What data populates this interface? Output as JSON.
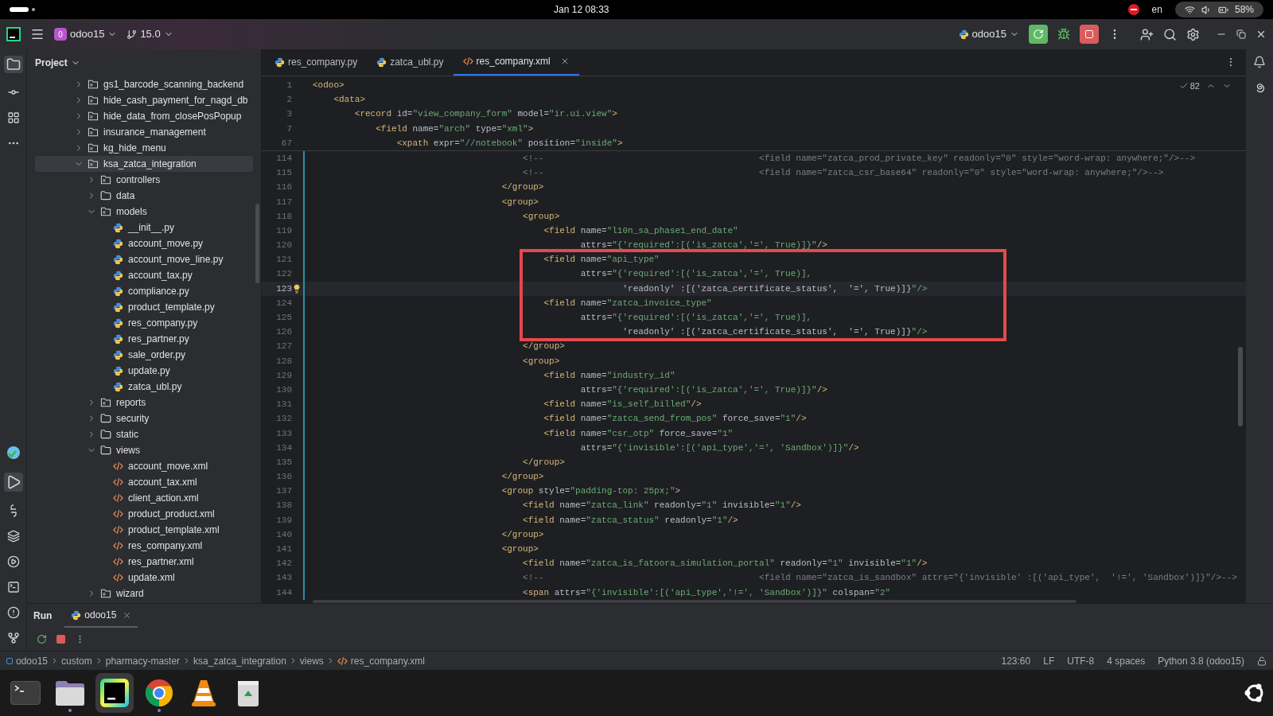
{
  "system_bar": {
    "date": "Jan 12",
    "time": "08:33",
    "language": "en",
    "battery": "58%"
  },
  "toolbar": {
    "project_badge": "0",
    "project": "odoo15",
    "branch": "15.0",
    "run_config": "odoo15"
  },
  "project_panel": {
    "title": "Project",
    "tree": [
      {
        "label": "gs1_barcode_scanning_backend",
        "kind": "package",
        "expanded": false,
        "selected": false
      },
      {
        "label": "hide_cash_payment_for_nagd_db",
        "kind": "package",
        "expanded": false,
        "selected": false
      },
      {
        "label": "hide_data_from_closePosPopup",
        "kind": "package",
        "expanded": false,
        "selected": false
      },
      {
        "label": "insurance_management",
        "kind": "package",
        "expanded": false,
        "selected": false
      },
      {
        "label": "kg_hide_menu",
        "kind": "package",
        "expanded": false,
        "selected": false
      },
      {
        "label": "ksa_zatca_integration",
        "kind": "package",
        "expanded": true,
        "selected": true,
        "children": [
          {
            "label": "controllers",
            "kind": "package",
            "expanded": false,
            "selected": false
          },
          {
            "label": "data",
            "kind": "folder",
            "expanded": false,
            "selected": false
          },
          {
            "label": "models",
            "kind": "package",
            "expanded": true,
            "selected": false,
            "children": [
              {
                "label": "__init__.py",
                "kind": "python",
                "selected": false
              },
              {
                "label": "account_move.py",
                "kind": "python",
                "selected": false
              },
              {
                "label": "account_move_line.py",
                "kind": "python",
                "selected": false
              },
              {
                "label": "account_tax.py",
                "kind": "python",
                "selected": false
              },
              {
                "label": "compliance.py",
                "kind": "python",
                "selected": false
              },
              {
                "label": "product_template.py",
                "kind": "python",
                "selected": false
              },
              {
                "label": "res_company.py",
                "kind": "python",
                "selected": false
              },
              {
                "label": "res_partner.py",
                "kind": "python",
                "selected": false
              },
              {
                "label": "sale_order.py",
                "kind": "python",
                "selected": false
              },
              {
                "label": "update.py",
                "kind": "python",
                "selected": false
              },
              {
                "label": "zatca_ubl.py",
                "kind": "python",
                "selected": false
              }
            ]
          },
          {
            "label": "reports",
            "kind": "package",
            "expanded": false,
            "selected": false
          },
          {
            "label": "security",
            "kind": "folder",
            "expanded": false,
            "selected": false
          },
          {
            "label": "static",
            "kind": "folder",
            "expanded": false,
            "selected": false
          },
          {
            "label": "views",
            "kind": "folder",
            "expanded": true,
            "selected": false,
            "children": [
              {
                "label": "account_move.xml",
                "kind": "xml",
                "selected": false
              },
              {
                "label": "account_tax.xml",
                "kind": "xml",
                "selected": false
              },
              {
                "label": "client_action.xml",
                "kind": "xml",
                "selected": false
              },
              {
                "label": "product_product.xml",
                "kind": "xml",
                "selected": false
              },
              {
                "label": "product_template.xml",
                "kind": "xml",
                "selected": false
              },
              {
                "label": "res_company.xml",
                "kind": "xml",
                "selected": false
              },
              {
                "label": "res_partner.xml",
                "kind": "xml",
                "selected": false
              },
              {
                "label": "update.xml",
                "kind": "xml",
                "selected": false
              }
            ]
          },
          {
            "label": "wizard",
            "kind": "package",
            "expanded": false,
            "selected": false
          }
        ]
      }
    ]
  },
  "editor": {
    "tabs": [
      {
        "label": "res_company.py",
        "kind": "python",
        "selected": false
      },
      {
        "label": "zatca_ubl.py",
        "kind": "python",
        "selected": false
      },
      {
        "label": "res_company.xml",
        "kind": "xml",
        "selected": true
      }
    ],
    "inspection_count": "82",
    "sticky_lines": [
      {
        "number": "1",
        "text": "<odoo>"
      },
      {
        "number": "2",
        "text": "    <data>"
      },
      {
        "number": "3",
        "text": "        <record id=\"view_company_form\" model=\"ir.ui.view\">"
      },
      {
        "number": "7",
        "text": "            <field name=\"arch\" type=\"xml\">"
      },
      {
        "number": "67",
        "text": "                <xpath expr=\"//notebook\" position=\"inside\">"
      }
    ],
    "lines": [
      {
        "number": "114",
        "text": "                                        <!--                                         <field name=\"zatca_prod_private_key\" readonly=\"0\" style=\"word-wrap: anywhere;\"/>-->",
        "current": false,
        "boxed": false
      },
      {
        "number": "115",
        "text": "                                        <!--                                         <field name=\"zatca_csr_base64\" readonly=\"0\" style=\"word-wrap: anywhere;\"/>-->",
        "current": false,
        "boxed": false
      },
      {
        "number": "116",
        "text": "                                    </group>",
        "current": false,
        "boxed": false
      },
      {
        "number": "117",
        "text": "                                    <group>",
        "current": false,
        "boxed": false
      },
      {
        "number": "118",
        "text": "                                        <group>",
        "current": false,
        "boxed": false
      },
      {
        "number": "119",
        "text": "                                            <field name=\"l10n_sa_phase1_end_date\"",
        "current": false,
        "boxed": false
      },
      {
        "number": "120",
        "text": "                                                   attrs=\"{'required':[('is_zatca','=', True)]}\"/>",
        "current": false,
        "boxed": false
      },
      {
        "number": "121",
        "text": "                                            <field name=\"api_type\"",
        "current": false,
        "boxed": true
      },
      {
        "number": "122",
        "text": "                                                   attrs=\"{'required':[('is_zatca','=', True)],",
        "current": false,
        "boxed": true
      },
      {
        "number": "123",
        "text": "                                                           'readonly' :[('zatca_certificate_status',  '=', True)]}\"/>",
        "current": true,
        "boxed": true
      },
      {
        "number": "124",
        "text": "                                            <field name=\"zatca_invoice_type\"",
        "current": false,
        "boxed": true
      },
      {
        "number": "125",
        "text": "                                                   attrs=\"{'required':[('is_zatca','=', True)],",
        "current": false,
        "boxed": true
      },
      {
        "number": "126",
        "text": "                                                           'readonly' :[('zatca_certificate_status',  '=', True)]}\"/>",
        "current": false,
        "boxed": true
      },
      {
        "number": "127",
        "text": "                                        </group>",
        "current": false,
        "boxed": false
      },
      {
        "number": "128",
        "text": "                                        <group>",
        "current": false,
        "boxed": false
      },
      {
        "number": "129",
        "text": "                                            <field name=\"industry_id\"",
        "current": false,
        "boxed": false
      },
      {
        "number": "130",
        "text": "                                                   attrs=\"{'required':[('is_zatca','=', True)]}\"/>",
        "current": false,
        "boxed": false
      },
      {
        "number": "131",
        "text": "                                            <field name=\"is_self_billed\"/>",
        "current": false,
        "boxed": false
      },
      {
        "number": "132",
        "text": "                                            <field name=\"zatca_send_from_pos\" force_save=\"1\"/>",
        "current": false,
        "boxed": false
      },
      {
        "number": "133",
        "text": "                                            <field name=\"csr_otp\" force_save=\"1\"",
        "current": false,
        "boxed": false
      },
      {
        "number": "134",
        "text": "                                                   attrs=\"{'invisible':[('api_type','=', 'Sandbox')]}\"/>",
        "current": false,
        "boxed": false
      },
      {
        "number": "135",
        "text": "                                        </group>",
        "current": false,
        "boxed": false
      },
      {
        "number": "136",
        "text": "                                    </group>",
        "current": false,
        "boxed": false
      },
      {
        "number": "137",
        "text": "                                    <group style=\"padding-top: 25px;\">",
        "current": false,
        "boxed": false
      },
      {
        "number": "138",
        "text": "                                        <field name=\"zatca_link\" readonly=\"1\" invisible=\"1\"/>",
        "current": false,
        "boxed": false
      },
      {
        "number": "139",
        "text": "                                        <field name=\"zatca_status\" readonly=\"1\"/>",
        "current": false,
        "boxed": false
      },
      {
        "number": "140",
        "text": "                                    </group>",
        "current": false,
        "boxed": false
      },
      {
        "number": "141",
        "text": "                                    <group>",
        "current": false,
        "boxed": false
      },
      {
        "number": "142",
        "text": "                                        <field name=\"zatca_is_fatoora_simulation_portal\" readonly=\"1\" invisible=\"1\"/>",
        "current": false,
        "boxed": false
      },
      {
        "number": "143",
        "text": "                                        <!--                                         <field name=\"zatca_is_sandbox\" attrs=\"{'invisible' :[('api_type',  '!=', 'Sandbox')]}\"/>-->",
        "current": false,
        "boxed": false
      },
      {
        "number": "144",
        "text": "                                        <span attrs=\"{'invisible':[('api_type','!=', 'Sandbox')]}\" colspan=\"2\"",
        "current": false,
        "boxed": false
      }
    ]
  },
  "run_panel": {
    "title": "Run",
    "tabs": [
      {
        "label": "odoo15",
        "kind": "python",
        "selected": true
      }
    ]
  },
  "status_bar": {
    "breadcrumbs": [
      {
        "label": "odoo15",
        "kind": "module"
      },
      {
        "label": "custom",
        "kind": "folder"
      },
      {
        "label": "pharmacy-master",
        "kind": "folder"
      },
      {
        "label": "ksa_zatca_integration",
        "kind": "folder"
      },
      {
        "label": "views",
        "kind": "folder"
      },
      {
        "label": "res_company.xml",
        "kind": "xml"
      }
    ],
    "position": "123:60",
    "line_separator": "LF",
    "encoding": "UTF-8",
    "indent": "4 spaces",
    "interpreter": "Python 3.8 (odoo15)"
  },
  "dock": [
    {
      "kind": "terminal",
      "running": false,
      "selected": false
    },
    {
      "kind": "files",
      "running": true,
      "selected": false
    },
    {
      "kind": "pycharm",
      "running": false,
      "selected": true
    },
    {
      "kind": "chrome",
      "running": true,
      "selected": false
    },
    {
      "kind": "vlc",
      "running": false,
      "selected": false
    },
    {
      "kind": "trash",
      "running": false,
      "selected": false
    }
  ]
}
